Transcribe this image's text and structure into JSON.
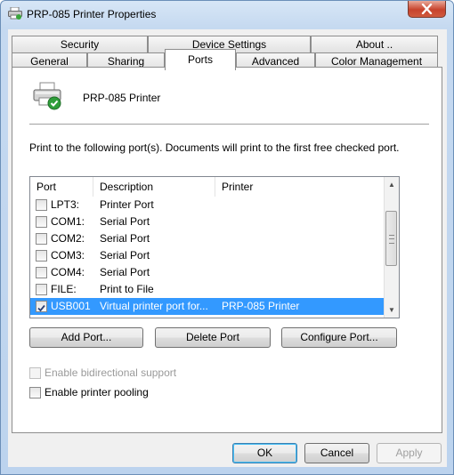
{
  "window": {
    "title": "PRP-085 Printer Properties"
  },
  "tabs": {
    "top_row": [
      {
        "label": "Security"
      },
      {
        "label": "Device Settings"
      },
      {
        "label": "About .."
      }
    ],
    "bottom_row": [
      {
        "label": "General"
      },
      {
        "label": "Sharing"
      },
      {
        "label": "Ports"
      },
      {
        "label": "Advanced"
      },
      {
        "label": "Color Management"
      }
    ],
    "active": "Ports"
  },
  "printer": {
    "name": "PRP-085 Printer"
  },
  "info_text": "Print to the following port(s). Documents will print to the first free checked port.",
  "port_list": {
    "columns": [
      "Port",
      "Description",
      "Printer"
    ],
    "rows": [
      {
        "port": "LPT3:",
        "description": "Printer Port",
        "printer": "",
        "checked": false,
        "selected": false
      },
      {
        "port": "COM1:",
        "description": "Serial Port",
        "printer": "",
        "checked": false,
        "selected": false
      },
      {
        "port": "COM2:",
        "description": "Serial Port",
        "printer": "",
        "checked": false,
        "selected": false
      },
      {
        "port": "COM3:",
        "description": "Serial Port",
        "printer": "",
        "checked": false,
        "selected": false
      },
      {
        "port": "COM4:",
        "description": "Serial Port",
        "printer": "",
        "checked": false,
        "selected": false
      },
      {
        "port": "FILE:",
        "description": "Print to File",
        "printer": "",
        "checked": false,
        "selected": false
      },
      {
        "port": "USB001",
        "description": "Virtual printer port for...",
        "printer": "PRP-085 Printer",
        "checked": true,
        "selected": true
      }
    ]
  },
  "port_buttons": {
    "add": "Add Port...",
    "delete": "Delete Port",
    "configure": "Configure Port..."
  },
  "options": {
    "bidirectional": {
      "label": "Enable bidirectional support",
      "checked": false,
      "enabled": false
    },
    "pooling": {
      "label": "Enable printer pooling",
      "checked": false,
      "enabled": true
    }
  },
  "dialog_buttons": {
    "ok": "OK",
    "cancel": "Cancel",
    "apply": "Apply"
  },
  "colors": {
    "selection": "#3399ff",
    "close_button": "#c7432c",
    "window_frame": "#c5d9f0"
  }
}
